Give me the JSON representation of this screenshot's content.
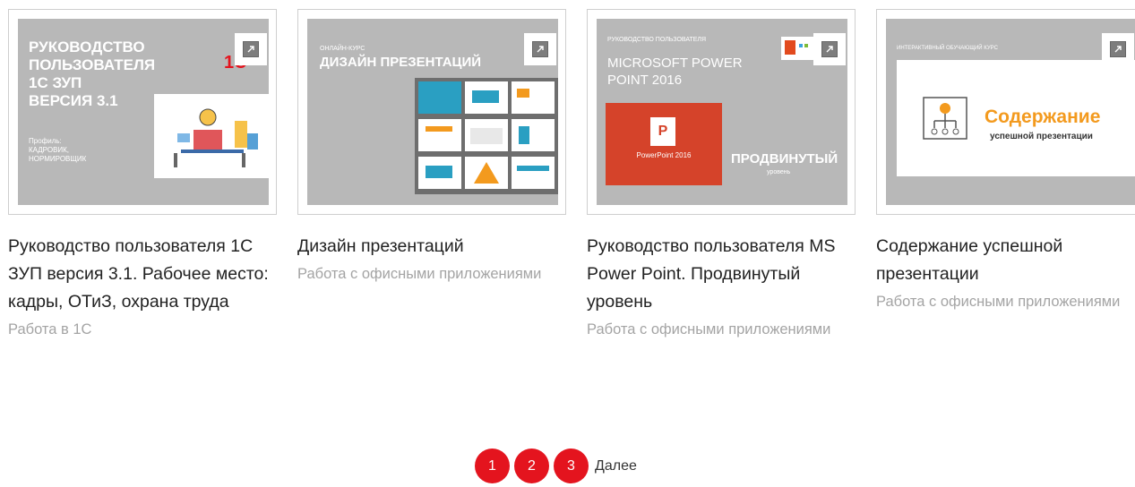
{
  "cards": [
    {
      "cover_lines": [
        "РУКОВОДСТВО",
        "ПОЛЬЗОВАТЕЛЯ",
        "1С ЗУП",
        "ВЕРСИЯ 3.1"
      ],
      "cover_small": [
        "Профиль:",
        "КАДРОВИК,",
        "НОРМИРОВЩИК"
      ],
      "cover_logo": "1С",
      "title": "Руководство пользователя 1С ЗУП версия 3.1. Рабочее место: кадры, ОТиЗ, охрана труда",
      "category": "Работа в 1С"
    },
    {
      "cover_kicker": "ОНЛАЙН-КУРС",
      "cover_heading": "ДИЗАЙН ПРЕЗЕНТАЦИЙ",
      "title": "Дизайн презентаций",
      "category": "Работа с офисными приложениями"
    },
    {
      "cover_kicker": "РУКОВОДСТВО ПОЛЬЗОВАТЕЛЯ",
      "cover_heading": "MICROSOFT POWER POINT 2016",
      "cover_badge": "ПРОДВИНУТЫЙ",
      "cover_badge_sub": "уровень",
      "cover_product": "PowerPoint 2016",
      "title": "Руководство пользователя MS Power Point. Продвинутый уровень",
      "category": "Работа с офисными приложениями"
    },
    {
      "cover_kicker": "ИНТЕРАКТИВНЫЙ ОБУЧАЮЩИЙ КУРС",
      "cover_heading": "Содержание",
      "cover_sub": "успешной презентации",
      "title": "Содержание успешной презентации",
      "category": "Работа с офисными приложениями"
    }
  ],
  "pagination": {
    "pages": [
      "1",
      "2",
      "3"
    ],
    "next_label": "Далее"
  },
  "colors": {
    "accent": "#e4141e",
    "muted": "#a4a4a4",
    "cover": "#b8b8b8",
    "orange": "#f39a1e"
  },
  "icons": {
    "external": "external-link-icon"
  }
}
